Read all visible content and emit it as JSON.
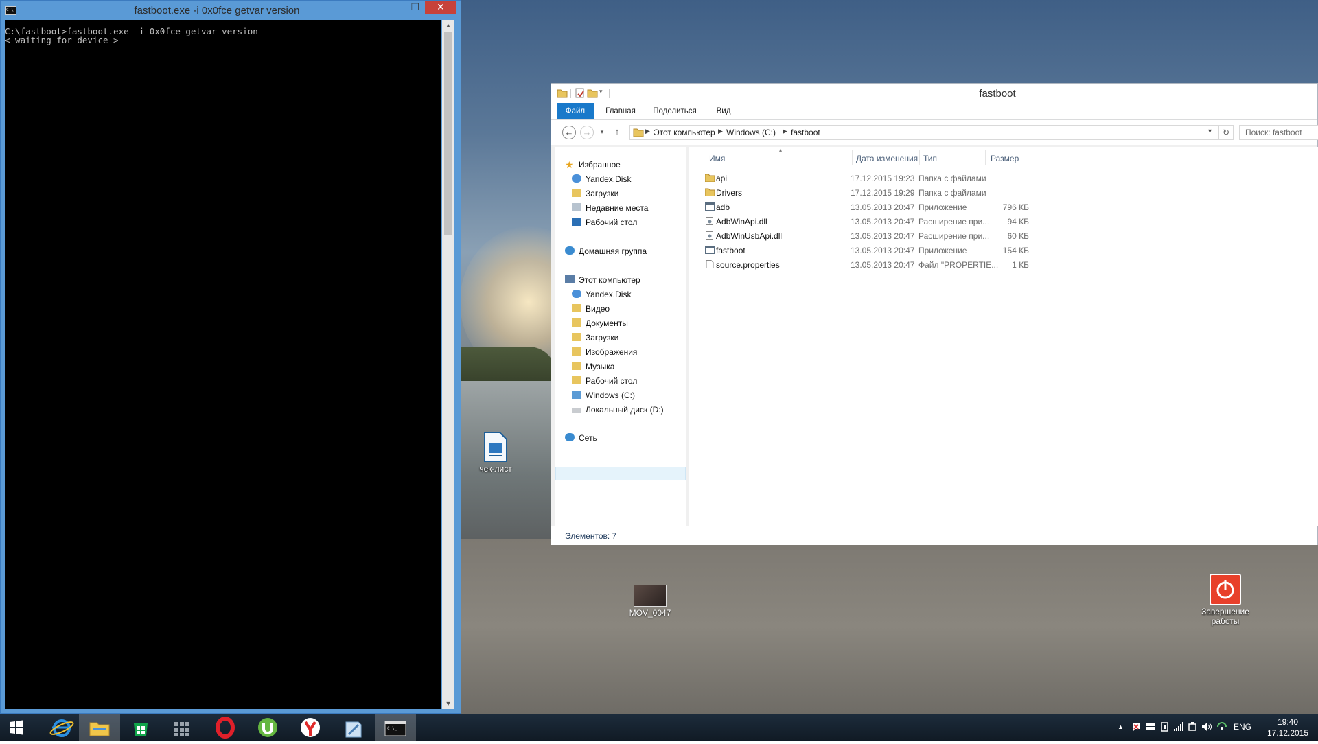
{
  "console": {
    "title": "fastboot.exe  -i 0x0fce getvar version",
    "app_icon": "C:\\",
    "lines": [
      "C:\\fastboot>fastboot.exe -i 0x0fce getvar version",
      "< waiting for device >"
    ],
    "controls": {
      "minimize": "–",
      "maximize": "❐",
      "close": "✕"
    }
  },
  "desktop": {
    "icons": [
      {
        "label": "чек-лист",
        "icon": "document-icon"
      },
      {
        "label": "MOV_0047",
        "icon": "video-thumbnail-icon"
      },
      {
        "label": "Завершение работы",
        "icon": "shutdown-icon"
      }
    ]
  },
  "explorer": {
    "title": "fastboot",
    "ribbon_tabs": [
      "Файл",
      "Главная",
      "Поделиться",
      "Вид"
    ],
    "breadcrumb": [
      "Этот компьютер",
      "Windows (C:)",
      "fastboot"
    ],
    "search_placeholder": "Поиск: fastboot",
    "nav": {
      "favorites": {
        "label": "Избранное",
        "items": [
          "Yandex.Disk",
          "Загрузки",
          "Недавние места",
          "Рабочий стол"
        ]
      },
      "homegroup": "Домашняя группа",
      "computer": {
        "label": "Этот компьютер",
        "items": [
          "Yandex.Disk",
          "Видео",
          "Документы",
          "Загрузки",
          "Изображения",
          "Музыка",
          "Рабочий стол",
          "Windows (C:)",
          "Локальный диск (D:)"
        ]
      },
      "network": "Сеть",
      "selected": "Windows (C:)"
    },
    "columns": [
      "Имя",
      "Дата изменения",
      "Тип",
      "Размер"
    ],
    "files": [
      {
        "name": "api",
        "date": "17.12.2015 19:23",
        "type": "Папка с файлами",
        "size": "",
        "icon": "folder-icon"
      },
      {
        "name": "Drivers",
        "date": "17.12.2015 19:29",
        "type": "Папка с файлами",
        "size": "",
        "icon": "folder-icon"
      },
      {
        "name": "adb",
        "date": "13.05.2013 20:47",
        "type": "Приложение",
        "size": "796 КБ",
        "icon": "application-icon"
      },
      {
        "name": "AdbWinApi.dll",
        "date": "13.05.2013 20:47",
        "type": "Расширение при...",
        "size": "94 КБ",
        "icon": "dll-icon"
      },
      {
        "name": "AdbWinUsbApi.dll",
        "date": "13.05.2013 20:47",
        "type": "Расширение при...",
        "size": "60 КБ",
        "icon": "dll-icon"
      },
      {
        "name": "fastboot",
        "date": "13.05.2013 20:47",
        "type": "Приложение",
        "size": "154 КБ",
        "icon": "application-icon"
      },
      {
        "name": "source.properties",
        "date": "13.05.2013 20:47",
        "type": "Файл \"PROPERTIE...",
        "size": "1 КБ",
        "icon": "file-icon"
      }
    ],
    "status": "Элементов: 7"
  },
  "taskbar": {
    "apps": [
      "start-icon",
      "internet-explorer-icon",
      "file-explorer-icon",
      "store-icon",
      "app-grid-icon",
      "opera-icon",
      "utorrent-icon",
      "yandex-browser-icon",
      "notepad-icon",
      "console-icon"
    ],
    "active": "console-icon",
    "tray": {
      "language": "ENG",
      "time": "19:40",
      "date": "17.12.2015"
    }
  },
  "colors": {
    "accent": "#1979ca",
    "close": "#c7423a",
    "console_frame": "#5a9ad6"
  }
}
